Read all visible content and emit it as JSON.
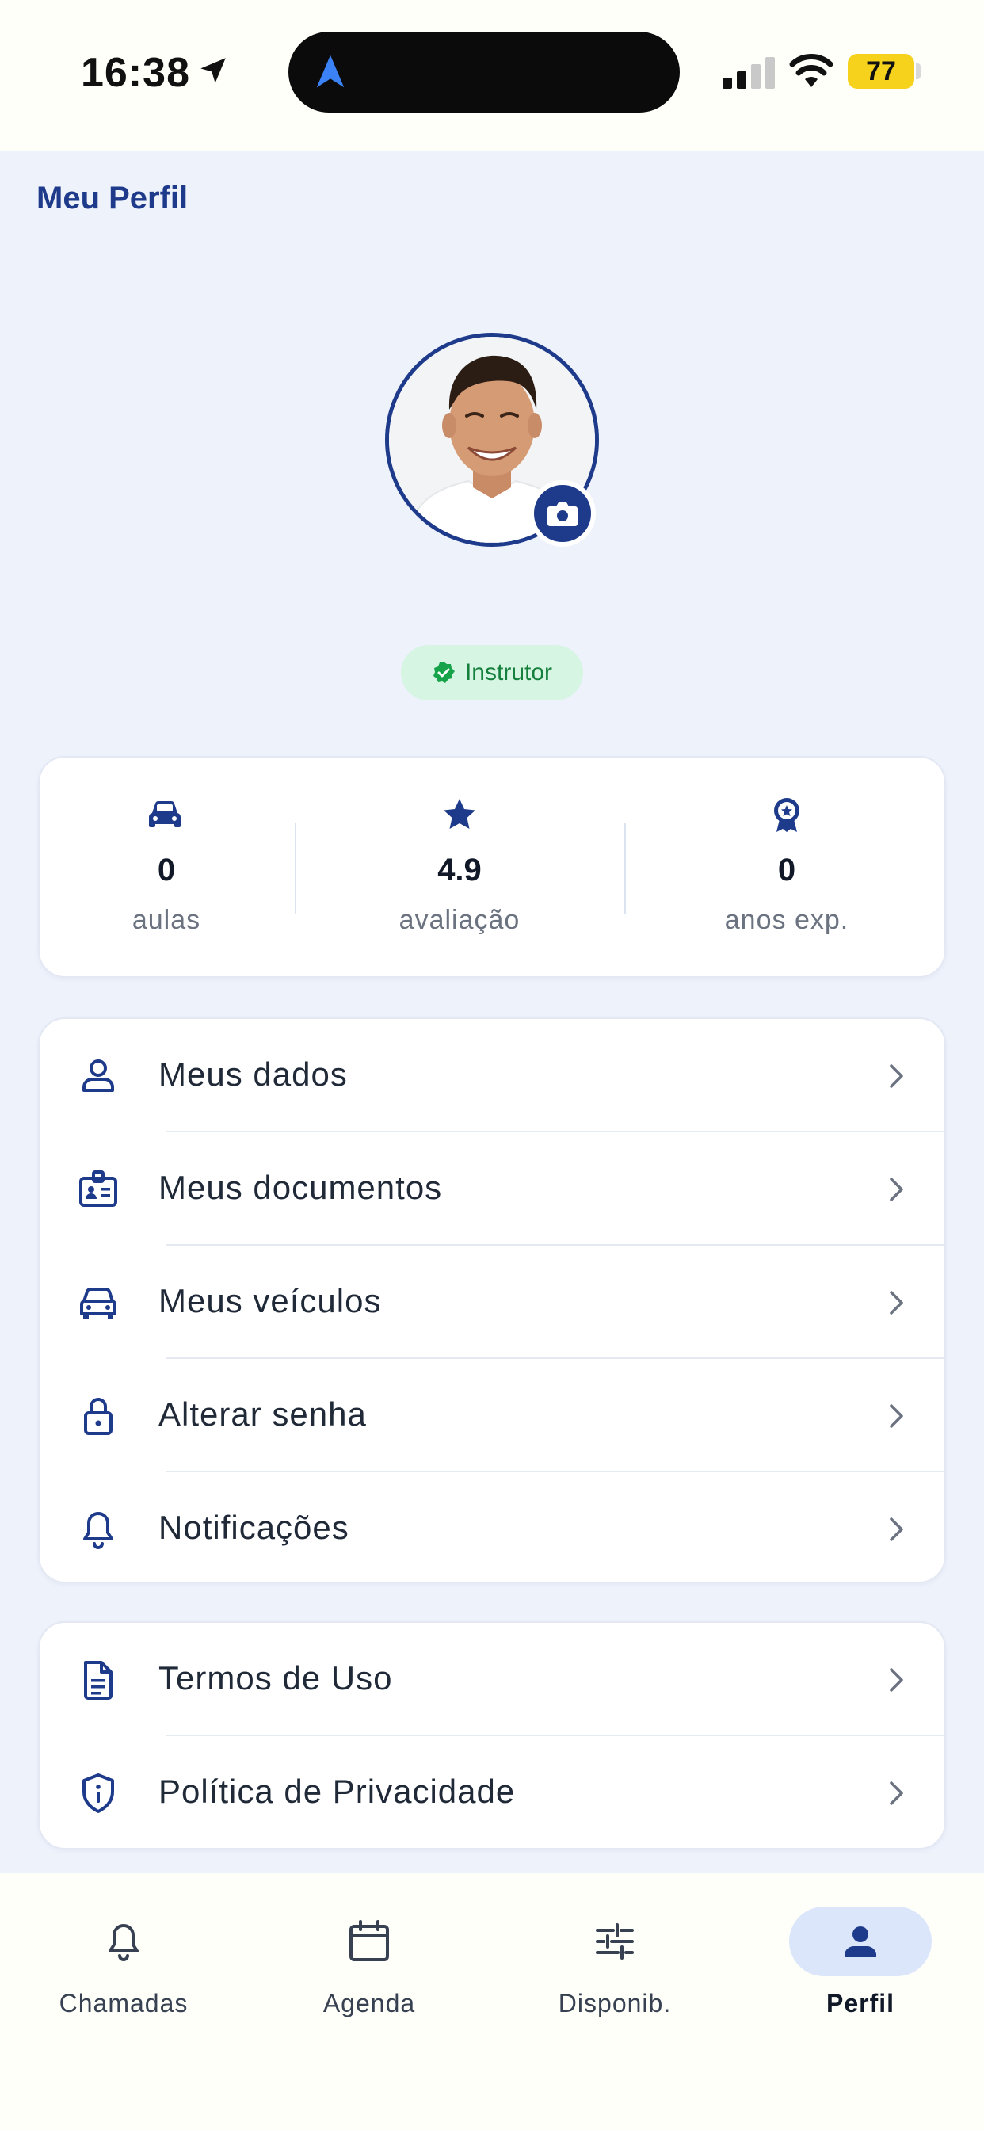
{
  "status_bar": {
    "time": "16:38",
    "battery": "77",
    "icons": [
      "location-arrow-icon",
      "navigation-icon",
      "signal-icon",
      "wifi-icon",
      "battery-icon"
    ]
  },
  "header": {
    "title": "Meu Perfil"
  },
  "profile": {
    "avatar_icon": "profile-photo",
    "camera_icon": "camera-icon",
    "role_badge": "Instrutor"
  },
  "stats": [
    {
      "icon": "car-icon",
      "value": "0",
      "label": "aulas"
    },
    {
      "icon": "star-icon",
      "value": "4.9",
      "label": "avaliação"
    },
    {
      "icon": "award-icon",
      "value": "0",
      "label": "anos exp."
    }
  ],
  "menu_account": [
    {
      "icon": "user-icon",
      "label": "Meus dados"
    },
    {
      "icon": "id-card-icon",
      "label": "Meus documentos"
    },
    {
      "icon": "car-icon",
      "label": "Meus veículos"
    },
    {
      "icon": "lock-icon",
      "label": "Alterar senha"
    },
    {
      "icon": "bell-icon",
      "label": "Notificações"
    }
  ],
  "menu_legal": [
    {
      "icon": "document-icon",
      "label": "Termos de Uso"
    },
    {
      "icon": "shield-info-icon",
      "label": "Política de Privacidade"
    }
  ],
  "bottom_nav": [
    {
      "icon": "bell-icon",
      "label": "Chamadas"
    },
    {
      "icon": "calendar-icon",
      "label": "Agenda"
    },
    {
      "icon": "sliders-icon",
      "label": "Disponib."
    },
    {
      "icon": "person-icon",
      "label": "Perfil",
      "active": true
    }
  ],
  "colors": {
    "brand": "#1e3a8a",
    "background": "#eef2fb",
    "badge_bg": "#d6f5e3",
    "badge_text": "#15803d",
    "active_pill": "#dbe6fb",
    "battery": "#f7d21d"
  }
}
